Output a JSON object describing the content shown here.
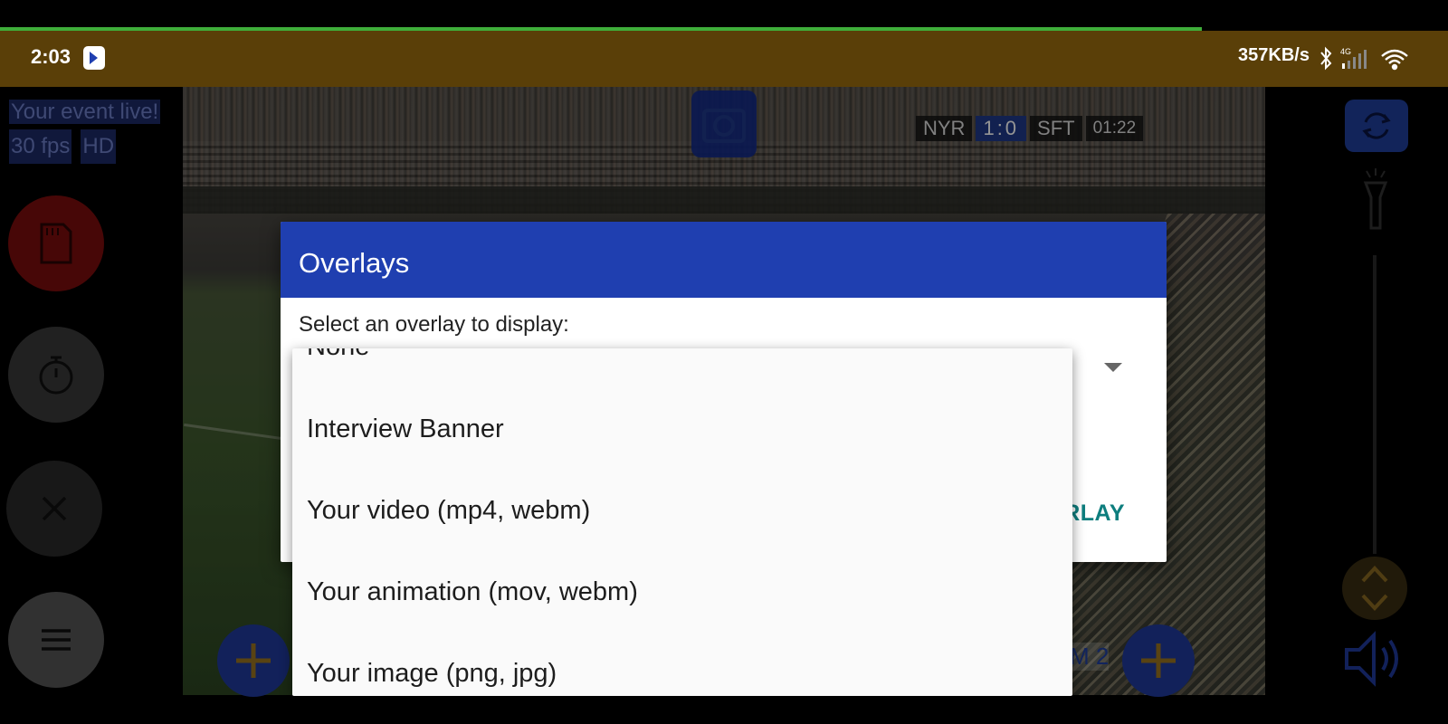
{
  "status_bar": {
    "time": "2:03",
    "network_speed": "357KB/s",
    "signal_label": "4G",
    "icons": [
      "app-icon",
      "bluetooth-icon",
      "signal-icon",
      "wifi-icon"
    ]
  },
  "preview": {
    "event_text_line1": "Your event live!",
    "event_fps": "30 fps",
    "event_quality": "HD",
    "scoreboard": {
      "home": "NYR",
      "score": "1:0",
      "away": "SFT",
      "clock": "01:22"
    },
    "stream_label": "M 2"
  },
  "dialog": {
    "title": "Overlays",
    "prompt": "Select an overlay to display:",
    "action_partial": "RLAY"
  },
  "dropdown": {
    "items": [
      "None",
      "Interview Banner",
      "Your video (mp4, webm)",
      "Your animation (mov, webm)",
      "Your image (png, jpg)"
    ]
  },
  "colors": {
    "status_bar": "#5a3f08",
    "dialog_header": "#1f3fb0",
    "accent_teal": "#0e7e7e",
    "record_red": "#7a0d0d"
  }
}
